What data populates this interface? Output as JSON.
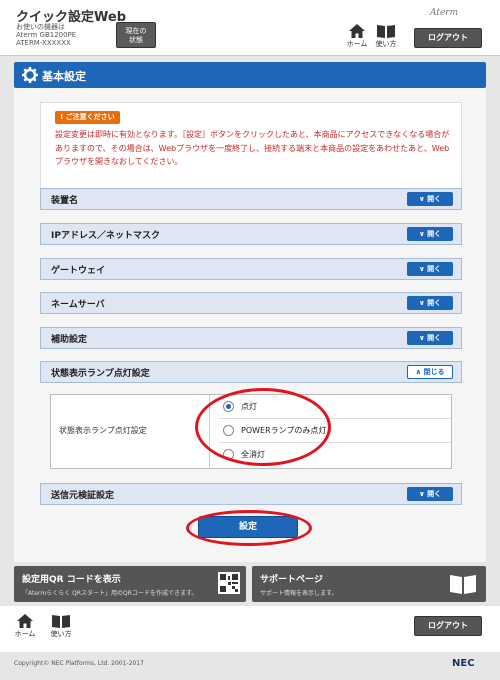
{
  "header": {
    "title": "クイック設定Web",
    "device_line1": "お使いの機器は",
    "device_line2": "Aterm GB1200PE",
    "device_line3": "ATERM-XXXXXX",
    "status_button_line1": "現在の",
    "status_button_line2": "状態",
    "home_label": "ホーム",
    "manual_label": "使い方",
    "brand": "Aterm",
    "logout_label": "ログアウト"
  },
  "section": {
    "title": "基本設定"
  },
  "notice": {
    "badge": "ご注意ください",
    "text": "設定変更は即時に有効となります。［設定］ボタンをクリックしたあと、本商品にアクセスできなくなる場合がありますので、その場合は、Webブラウザを一度終了し、接続する端末と本商品の設定をあわせたあと、Webブラウザを開きなおしてください。"
  },
  "accordions": [
    {
      "label": "装置名",
      "button": "開く"
    },
    {
      "label": "IPアドレス／ネットマスク",
      "button": "開く"
    },
    {
      "label": "ゲートウェイ",
      "button": "開く"
    },
    {
      "label": "ネームサーバ",
      "button": "開く"
    },
    {
      "label": "補助設定",
      "button": "開く"
    },
    {
      "label": "状態表示ランプ点灯設定",
      "button": "閉じる"
    },
    {
      "label": "送信元検証設定",
      "button": "開く"
    }
  ],
  "lamp_setting": {
    "label": "状態表示ランプ点灯設定",
    "options": [
      "点灯",
      "POWERランプのみ点灯",
      "全消灯"
    ],
    "selected": 0
  },
  "submit_label": "設定",
  "cards": {
    "qr_title": "設定用QR コードを表示",
    "qr_desc": "「Atermらくらく QRスタート」用のQRコードを作成できます。",
    "support_title": "サポートページ",
    "support_desc": "サポート情報を表示します。"
  },
  "footer": {
    "home_label": "ホーム",
    "manual_label": "使い方",
    "logout_label": "ログアウト",
    "copyright": "Copyright© NEC Platforms, Ltd. 2001-2017",
    "nec": "NEC"
  },
  "colors": {
    "primary": "#1d66b8",
    "warning": "#e86d0c",
    "notice_text": "#c62828",
    "highlight": "#e0141e"
  }
}
